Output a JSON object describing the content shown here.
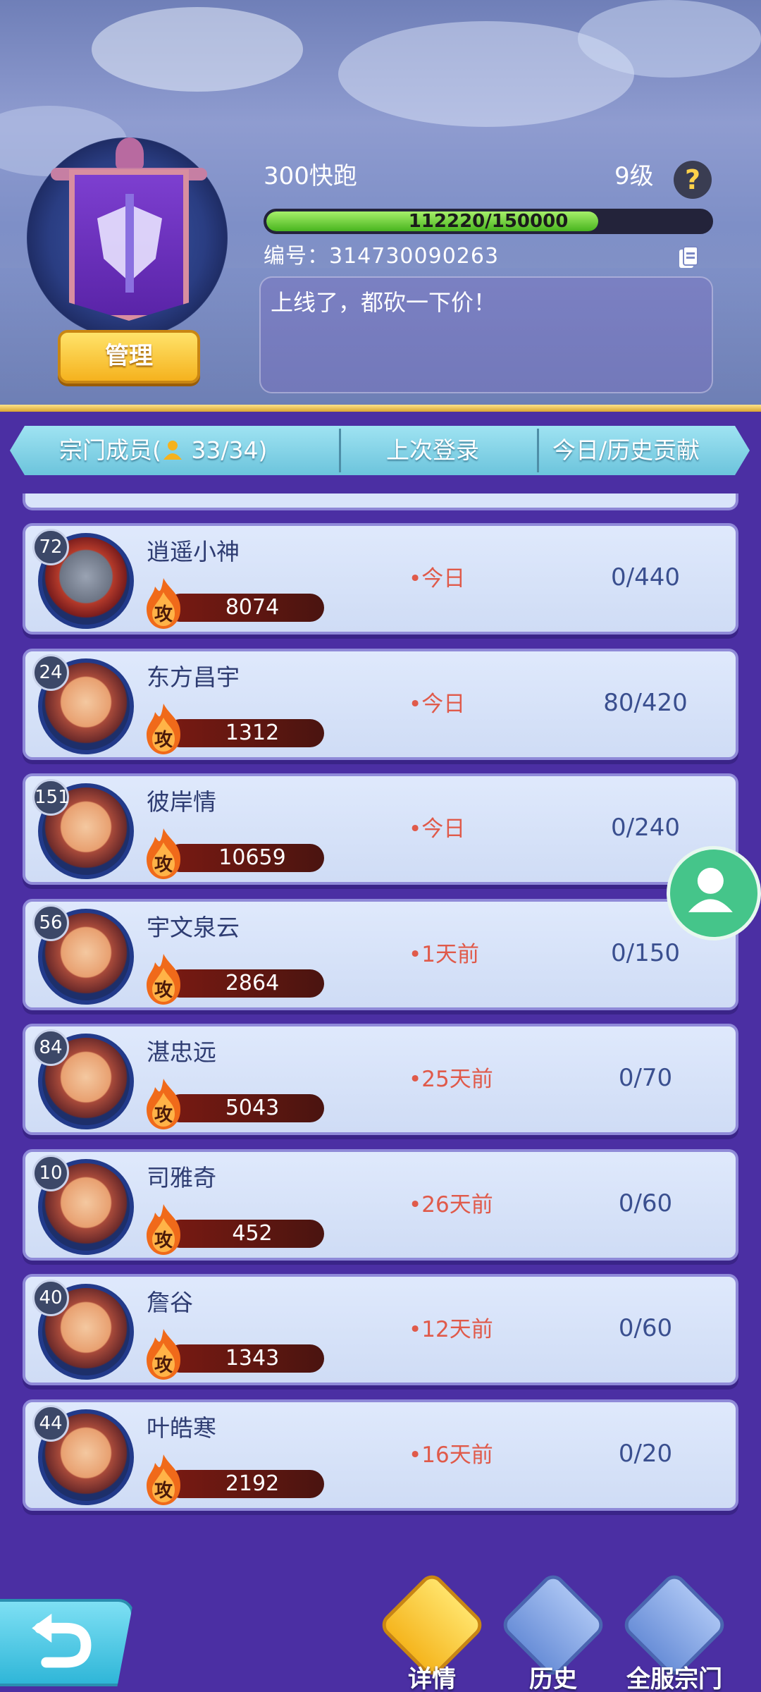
{
  "guild": {
    "name": "300快跑",
    "level": "9级",
    "xp_text": "112220/150000",
    "xp_ratio": 0.748,
    "id_text": "编号：314730090263",
    "notice": "上线了，都砍一下价！",
    "manage_label": "管理",
    "help_label": "?"
  },
  "header": {
    "members_label": "宗门成员(",
    "members_count": "33/34)",
    "last_login_label": "上次登录",
    "contribution_label": "今日/历史贡献"
  },
  "members": [
    {
      "level": "72",
      "name": "逍遥小神",
      "power": "8074",
      "login": "•今日",
      "contrib": "0/440",
      "avatar": "knight"
    },
    {
      "level": "24",
      "name": "东方昌宇",
      "power": "1312",
      "login": "•今日",
      "contrib": "80/420",
      "avatar": "girl"
    },
    {
      "level": "151",
      "name": "彼岸情",
      "power": "10659",
      "login": "•今日",
      "contrib": "0/240",
      "avatar": "girl"
    },
    {
      "level": "56",
      "name": "宇文泉云",
      "power": "2864",
      "login": "•1天前",
      "contrib": "0/150",
      "avatar": "girl"
    },
    {
      "level": "84",
      "name": "湛忠远",
      "power": "5043",
      "login": "•25天前",
      "contrib": "0/70",
      "avatar": "girl"
    },
    {
      "level": "10",
      "name": "司雅奇",
      "power": "452",
      "login": "•26天前",
      "contrib": "0/60",
      "avatar": "girl"
    },
    {
      "level": "40",
      "name": "詹谷",
      "power": "1343",
      "login": "•12天前",
      "contrib": "0/60",
      "avatar": "girl"
    },
    {
      "level": "44",
      "name": "叶皓寒",
      "power": "2192",
      "login": "•16天前",
      "contrib": "0/20",
      "avatar": "girl"
    }
  ],
  "power_badge": "攻",
  "bottom_nav": [
    {
      "label": "详情",
      "color": "#f5b51e",
      "active": true
    },
    {
      "label": "历史",
      "color": "#6a8fd8",
      "active": false
    },
    {
      "label": "全服宗门",
      "color": "#6a8fd8",
      "active": false
    }
  ],
  "colors": {
    "accent_gold": "#f5b21e",
    "login_red": "#e05a4a",
    "contrib_blue": "#3a4f8f",
    "panel_purple": "#4b2fa3"
  }
}
